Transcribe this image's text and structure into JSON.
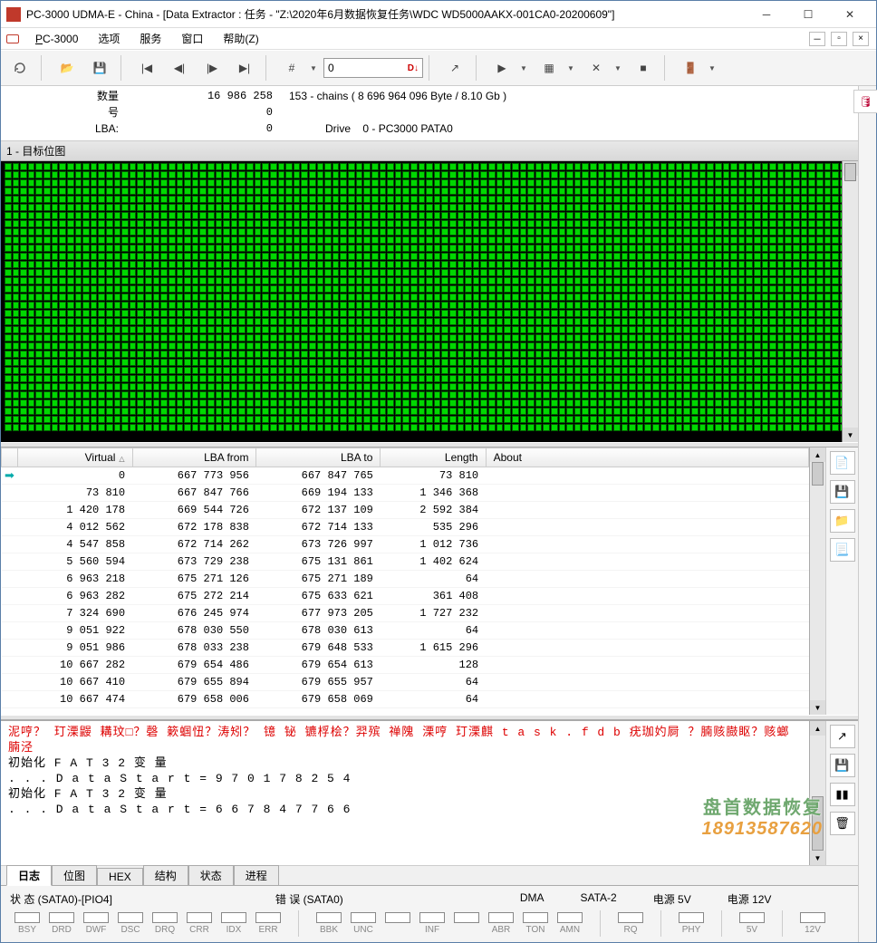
{
  "window": {
    "title": "PC-3000 UDMA-E - China - [Data Extractor : 任务 - \"Z:\\2020年6月数据恢复任务\\WDC WD5000AAKX-001CA0-20200609\"]"
  },
  "menu": {
    "pc3000": "PC-3000",
    "options": "选项",
    "service": "服务",
    "window": "窗口",
    "help": "帮助(Z)"
  },
  "toolbar": {
    "goto_value": "0",
    "goto_marker": "D↓"
  },
  "info": {
    "qty_label": "数量",
    "qty_value": "16 986 258",
    "qty_extra": "153 - chains  ( 8 696 964 096 Byte /  8.10 Gb )",
    "num_label": "号",
    "num_value": "0",
    "lba_label": "LBA:",
    "lba_value": "0",
    "drive_label": "Drive",
    "drive_value": "0 - PC3000 PATA0"
  },
  "bitmap_title": "1 - 目标位图",
  "table": {
    "headers": {
      "virtual": "Virtual",
      "lba_from": "LBA from",
      "lba_to": "LBA to",
      "length": "Length",
      "about": "About"
    },
    "rows": [
      {
        "virtual": "0",
        "from": "667 773 956",
        "to": "667 847 765",
        "len": "73 810",
        "arrow": true
      },
      {
        "virtual": "73 810",
        "from": "667 847 766",
        "to": "669 194 133",
        "len": "1 346 368"
      },
      {
        "virtual": "1 420 178",
        "from": "669 544 726",
        "to": "672 137 109",
        "len": "2 592 384"
      },
      {
        "virtual": "4 012 562",
        "from": "672 178 838",
        "to": "672 714 133",
        "len": "535 296"
      },
      {
        "virtual": "4 547 858",
        "from": "672 714 262",
        "to": "673 726 997",
        "len": "1 012 736"
      },
      {
        "virtual": "5 560 594",
        "from": "673 729 238",
        "to": "675 131 861",
        "len": "1 402 624"
      },
      {
        "virtual": "6 963 218",
        "from": "675 271 126",
        "to": "675 271 189",
        "len": "64"
      },
      {
        "virtual": "6 963 282",
        "from": "675 272 214",
        "to": "675 633 621",
        "len": "361 408"
      },
      {
        "virtual": "7 324 690",
        "from": "676 245 974",
        "to": "677 973 205",
        "len": "1 727 232"
      },
      {
        "virtual": "9 051 922",
        "from": "678 030 550",
        "to": "678 030 613",
        "len": "64"
      },
      {
        "virtual": "9 051 986",
        "from": "678 033 238",
        "to": "679 648 533",
        "len": "1 615 296"
      },
      {
        "virtual": "10 667 282",
        "from": "679 654 486",
        "to": "679 654 613",
        "len": "128"
      },
      {
        "virtual": "10 667 410",
        "from": "679 655 894",
        "to": "679 655 957",
        "len": "64"
      },
      {
        "virtual": "10 667 474",
        "from": "679 658 006",
        "to": "679 658 069",
        "len": "64"
      }
    ]
  },
  "log": {
    "line1": "泥哼？  玎溧鼹  耩玟□？磬  簌蝈忸？涛矧？  镱    铋  镳桴桧？羿殡  禅隗   溧哼    玎溧麒  t a s k . f d b   疣珈妁屙  ？腩赅臌眍？赅螂腩泾",
    "line2": "初始化  F A T 3 2   变 量",
    "line3": "  . . . D a t a S t a r t   =   9 7 0 1 7 8 2 5 4",
    "line4": "初始化  F A T 3 2   变 量",
    "line5": "  . . . D a t a S t a r t   =   6 6 7 8 4 7 7 6 6"
  },
  "tabs": {
    "log": "日志",
    "bitmap": "位图",
    "hex": "HEX",
    "struct": "结构",
    "status": "状态",
    "progress": "进程"
  },
  "status": {
    "state": "状 态 (SATA0)-[PIO4]",
    "error": "错 误 (SATA0)",
    "dma": "DMA",
    "sata2": "SATA-2",
    "pwr5": "电源 5V",
    "pwr12": "电源 12V",
    "leds_state": [
      "BSY",
      "DRD",
      "DWF",
      "DSC",
      "DRQ",
      "CRR",
      "IDX",
      "ERR"
    ],
    "leds_error": [
      "BBK",
      "UNC",
      "",
      "INF",
      "",
      "ABR",
      "TON",
      "AMN"
    ],
    "leds_dma": [
      "RQ"
    ],
    "leds_sata": [
      "PHY"
    ],
    "leds_p5": [
      "5V"
    ],
    "leds_p12": [
      "12V"
    ]
  },
  "watermark": {
    "l1": "盘首数据恢复",
    "l2": "18913587620"
  }
}
